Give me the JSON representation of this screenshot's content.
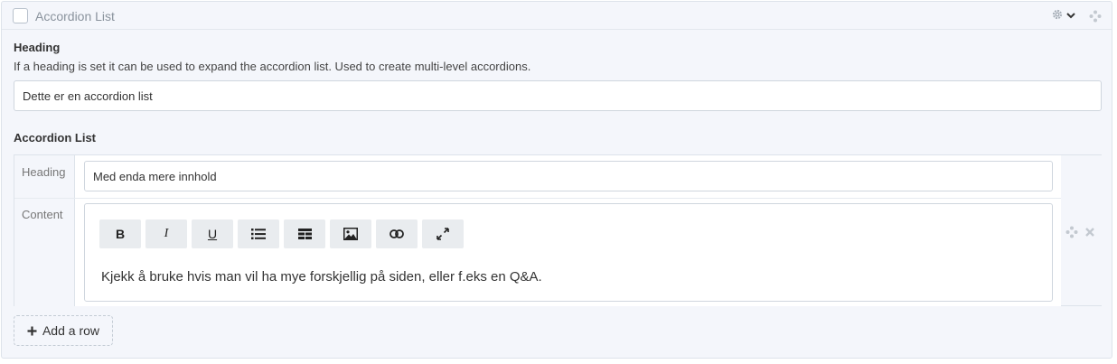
{
  "block": {
    "title": "Accordion List",
    "heading_label": "Heading",
    "heading_help": "If a heading is set it can be used to expand the accordion list. Used to create multi-level accordions.",
    "heading_value": "Dette er en accordion list",
    "list_label": "Accordion List"
  },
  "row": {
    "heading_label": "Heading",
    "heading_value": "Med enda mere innhold",
    "content_label": "Content",
    "content_text": "Kjekk å bruke hvis man vil ha mye forskjellig på siden, eller f.eks en Q&A."
  },
  "toolbar": {
    "bold": "B",
    "italic": "I",
    "underline": "U",
    "buttons": [
      "bold",
      "italic",
      "underline",
      "bullet-list",
      "table",
      "image",
      "link",
      "fullscreen"
    ]
  },
  "add_row_label": "Add a row",
  "icons": [
    "gear-icon",
    "chevron-down-icon",
    "move-icon",
    "close-icon",
    "plus-icon"
  ],
  "colors": {
    "panel_bg": "#f4f6fb",
    "border": "#dde3ea",
    "toolbar_btn": "#e9ecef"
  }
}
